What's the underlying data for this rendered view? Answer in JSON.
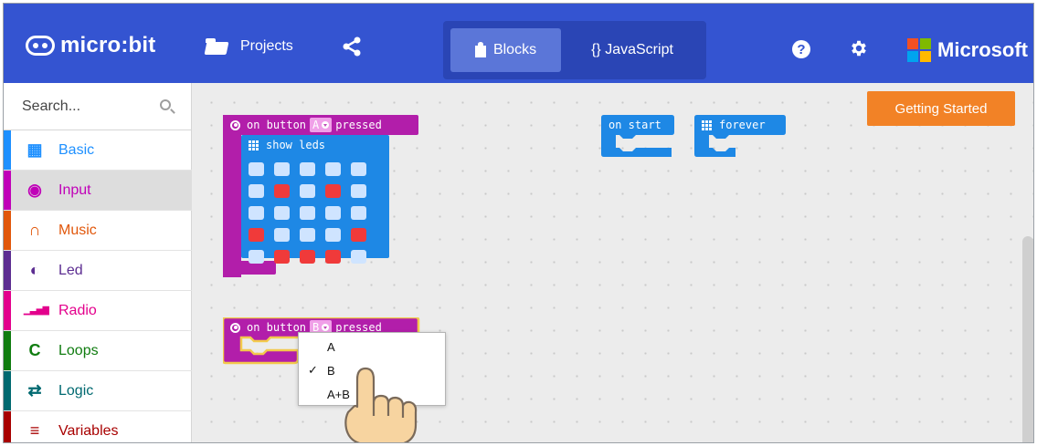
{
  "header": {
    "logo_text": "micro:bit",
    "projects_label": "Projects",
    "blocks_label": "Blocks",
    "javascript_label": "{} JavaScript",
    "help_glyph": "?",
    "brand": "Microsoft",
    "colors": {
      "bar": "#3454d1",
      "toggle": "#2a45b5",
      "selected": "#5b76d8"
    }
  },
  "sidebar": {
    "search_placeholder": "Search...",
    "items": [
      {
        "label": "Basic",
        "color": "#1e90ff",
        "icon": "grid-icon",
        "glyph": "▦"
      },
      {
        "label": "Input",
        "color": "#c000b8",
        "icon": "target-icon",
        "glyph": "◉"
      },
      {
        "label": "Music",
        "color": "#e1570b",
        "icon": "headphones-icon",
        "glyph": "∩"
      },
      {
        "label": "Led",
        "color": "#5c2d91",
        "icon": "toggle-icon",
        "glyph": "◐"
      },
      {
        "label": "Radio",
        "color": "#e3008c",
        "icon": "signal-icon",
        "glyph": "▁▃▅▇"
      },
      {
        "label": "Loops",
        "color": "#107c10",
        "icon": "refresh-icon",
        "glyph": "C"
      },
      {
        "label": "Logic",
        "color": "#006970",
        "icon": "shuffle-icon",
        "glyph": "⇄"
      },
      {
        "label": "Variables",
        "color": "#a80000",
        "icon": "list-icon",
        "glyph": "≡"
      }
    ]
  },
  "workspace": {
    "getting_started": "Getting Started",
    "block_a": {
      "prefix": "on button",
      "button": "A",
      "suffix": "pressed",
      "show_leds": "show leds",
      "leds": [
        [
          0,
          0,
          0,
          0,
          0
        ],
        [
          0,
          1,
          0,
          1,
          0
        ],
        [
          0,
          0,
          0,
          0,
          0
        ],
        [
          1,
          0,
          0,
          0,
          1
        ],
        [
          0,
          1,
          1,
          1,
          0
        ]
      ]
    },
    "on_start": "on start",
    "forever": "forever",
    "block_b": {
      "prefix": "on button",
      "button": "B",
      "suffix": "pressed"
    },
    "dropdown": {
      "options": [
        {
          "label": "A",
          "checked": false
        },
        {
          "label": "B",
          "checked": true
        },
        {
          "label": "A+B",
          "checked": false
        }
      ],
      "check_glyph": "✓"
    }
  }
}
